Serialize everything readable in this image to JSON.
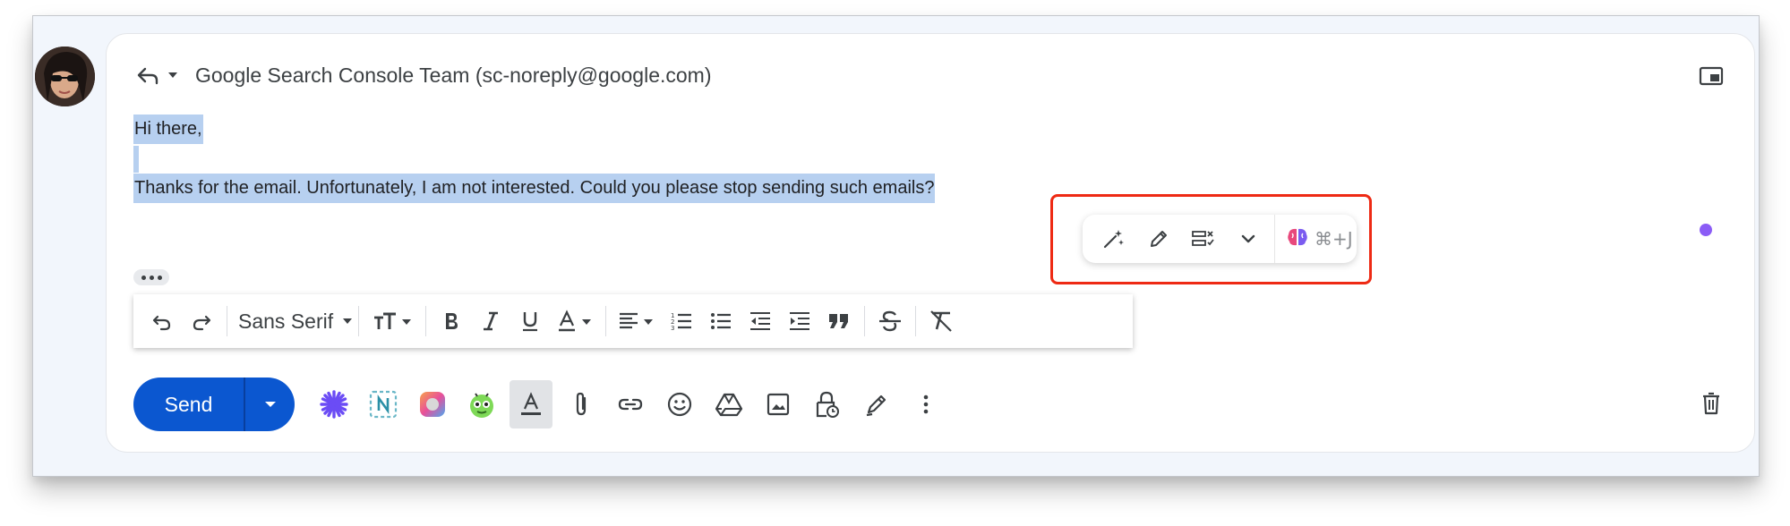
{
  "header": {
    "recipient": "Google Search Console Team (sc-noreply@google.com)"
  },
  "message": {
    "line1": "Hi there,",
    "line3": "Thanks for the email. Unfortunately, I am not interested. Could you please stop sending such emails?"
  },
  "ai_toolbar": {
    "shortcut": "⌘+J",
    "buttons": [
      "magic-wand-icon",
      "pencil-icon",
      "proofread-icon",
      "chevron-down-icon"
    ],
    "highlight_color": "#ee2a14"
  },
  "formatting": {
    "font": "Sans Serif"
  },
  "compose_actions": {
    "send_label": "Send",
    "send_color": "#0b57d0"
  },
  "colors": {
    "selection": "#b7d0f0",
    "status_dot": "#8b5cf6"
  }
}
